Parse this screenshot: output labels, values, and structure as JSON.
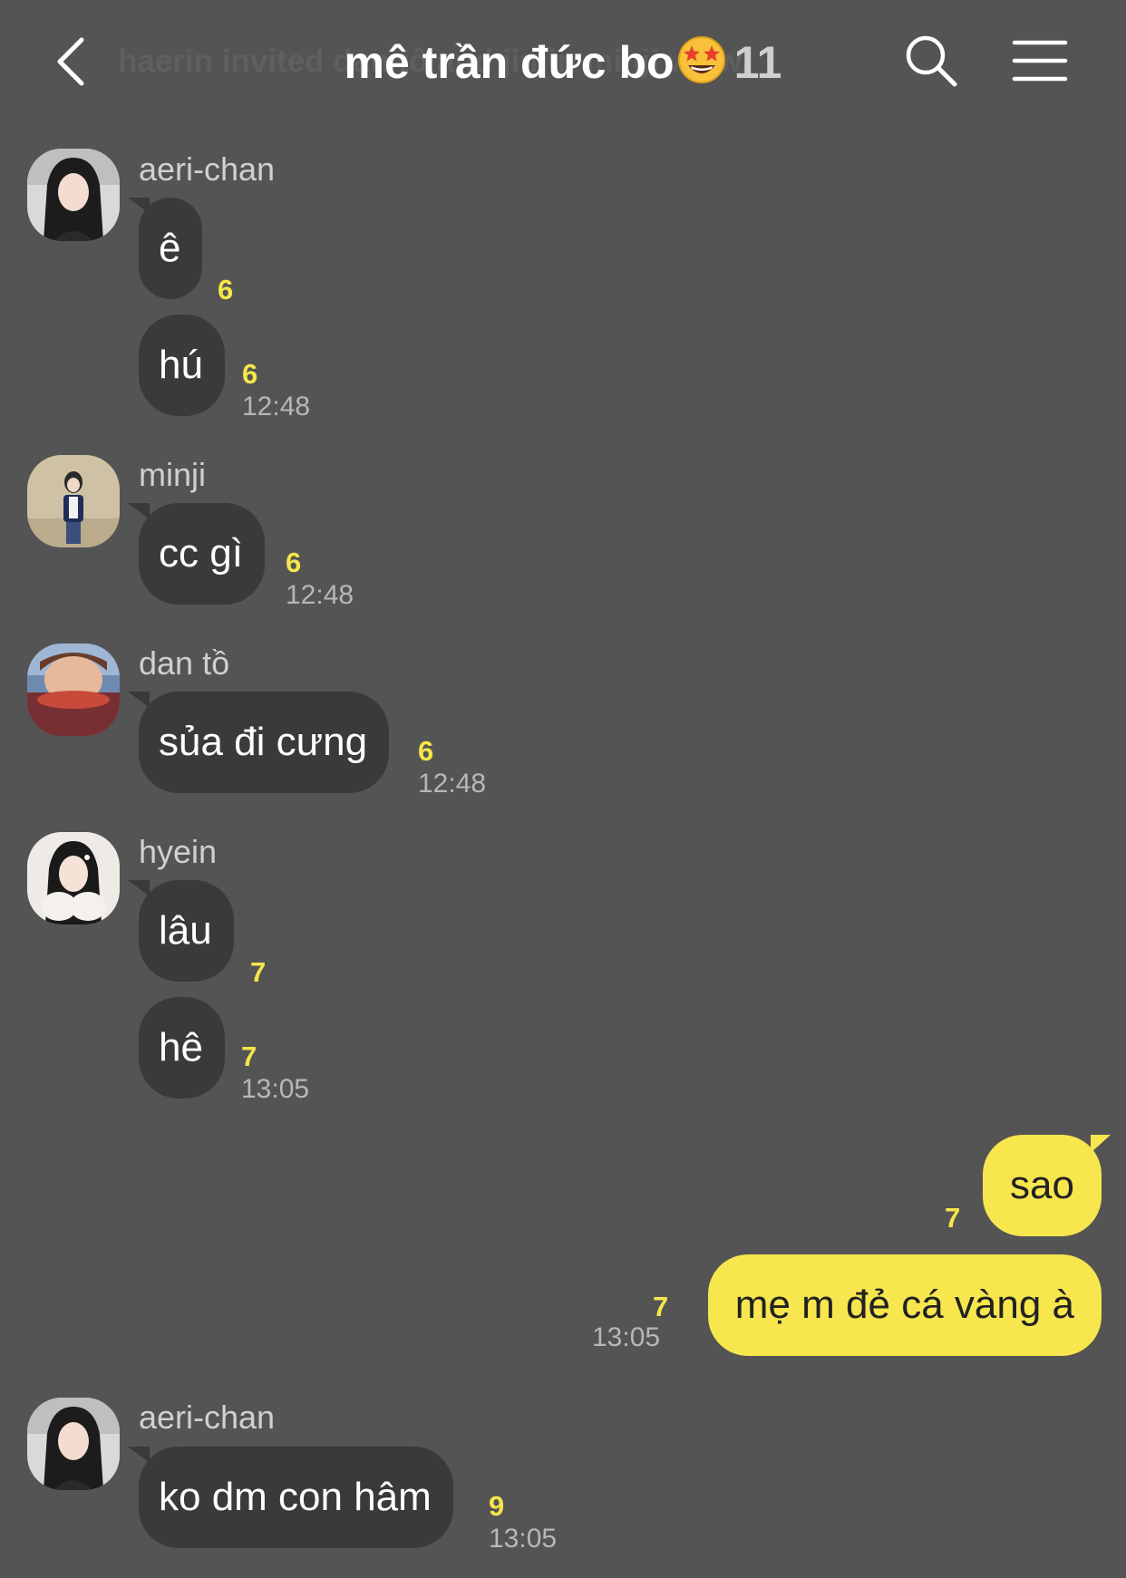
{
  "header": {
    "marquee": "haerin invited dan tồ and jimin minji www.",
    "title": "mê trần đức bo",
    "title_emoji": "star-struck-emoji",
    "member_count": "11",
    "icons": [
      "chevron-left-icon",
      "search-icon",
      "hamburger-menu-icon"
    ]
  },
  "messages": [
    {
      "sender": "aeri-chan",
      "text": "ê",
      "unread": "6"
    },
    {
      "text": "hú",
      "unread": "6",
      "time": "12:48"
    },
    {
      "sender": "minji",
      "text": "cc gì",
      "unread": "6",
      "time": "12:48"
    },
    {
      "sender": "dan tồ",
      "text": "sủa đi cưng",
      "unread": "6",
      "time": "12:48"
    },
    {
      "sender": "hyein",
      "text": "lâu",
      "unread": "7"
    },
    {
      "text": "hê",
      "unread": "7",
      "time": "13:05"
    },
    {
      "mine": true,
      "text": "sao",
      "unread": "7"
    },
    {
      "mine": true,
      "text": "mẹ m đẻ cá vàng à",
      "unread": "7",
      "time": "13:05"
    },
    {
      "sender": "aeri-chan",
      "text": "ko dm con hâm",
      "unread": "9",
      "time": "13:05"
    }
  ],
  "colors": {
    "background": "#545454",
    "incoming_bubble": "#3a3a3a",
    "outgoing_bubble": "#f7e64e",
    "unread_count": "#f5e64a"
  }
}
